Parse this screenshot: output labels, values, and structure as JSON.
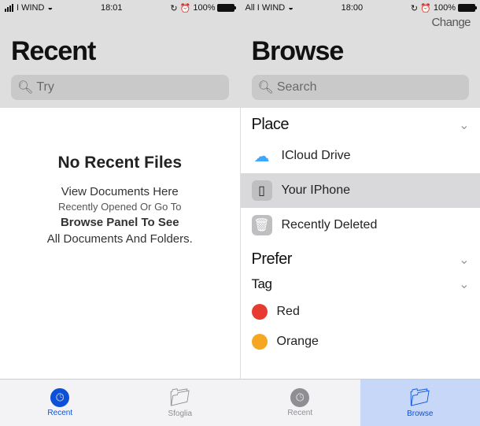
{
  "left": {
    "status": {
      "carrier": "I WIND",
      "time": "18:01",
      "battery": "100%"
    },
    "title": "Recent",
    "search_placeholder": "Try",
    "empty": {
      "title": "No Recent Files",
      "line1": "View Documents Here",
      "line2": "Recently Opened Or Go To",
      "line3": "Browse Panel To See",
      "line4": "All Documents And Folders."
    }
  },
  "right": {
    "status": {
      "carrier": "All I WIND",
      "time": "18:00",
      "battery": "100%"
    },
    "header_action": "Change",
    "title": "Browse",
    "search_placeholder": "Search",
    "section_place": "Place",
    "rows": {
      "icloud": "ICloud Drive",
      "iphone": "Your IPhone",
      "deleted": "Recently Deleted"
    },
    "section_prefer": "Prefer",
    "section_tag": "Tag",
    "tags": {
      "red": {
        "label": "Red",
        "color": "#e63b2e"
      },
      "orange": {
        "label": "Orange",
        "color": "#f5a623"
      }
    }
  },
  "tabs": {
    "t1": "Recent",
    "t2": "Sfoglia",
    "t3": "Recent",
    "t4": "Browse"
  }
}
